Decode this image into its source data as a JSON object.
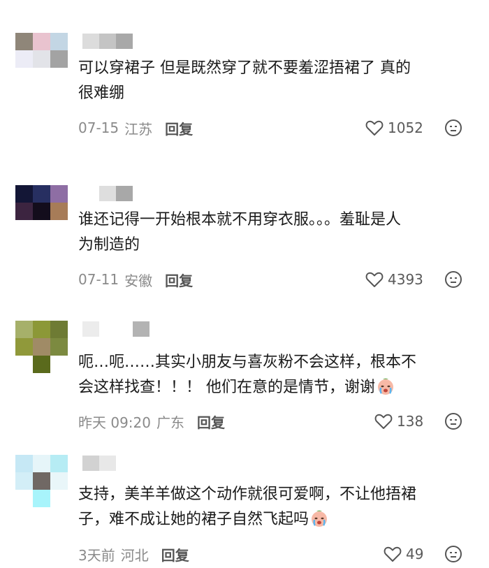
{
  "comments": [
    {
      "avatar_colors": [
        "#8f8679",
        "#e9c3cf",
        "#c3d6e4",
        "#ececf6",
        "#e2e3e8",
        "#a3a3a3",
        "#ffffff",
        "#ffffff",
        "#ffffff"
      ],
      "name_colors": [
        "#dcdcdc",
        "#c4c4c4",
        "#a8a8a8"
      ],
      "text": "可以穿裙子 但是既然穿了就不要羞涩捂裙了 真的\n很难绷",
      "date": "07-15",
      "location": "江苏",
      "reply_label": "回复",
      "likes": "1052"
    },
    {
      "avatar_colors": [
        "#131636",
        "#272f61",
        "#8e6ea4",
        "#3c2440",
        "#130d1c",
        "#a77c58",
        "#ffffff",
        "#ffffff",
        "#ffffff"
      ],
      "name_colors": [
        "#ffffff",
        "#dedede",
        "#a8a8a8"
      ],
      "text": "谁还记得一开始根本就不用穿衣服。。。羞耻是人\n为制造的",
      "date": "07-11",
      "location": "安徽",
      "reply_label": "回复",
      "likes": "4393"
    },
    {
      "avatar_colors": [
        "#a6b06a",
        "#8c9837",
        "#6e7b34",
        "#90993a",
        "#a08b66",
        "#7c8a40",
        "#ffffff",
        "#5a6a1c",
        "#ffffff"
      ],
      "name_colors": [
        "#ececec",
        "#ffffff",
        "#ffffff",
        "#b3b3b3"
      ],
      "text": "呃…呃……其实小朋友与喜灰粉不会这样，根本不\n会这样找查！！！ 他们在意的是情节，谢谢",
      "date": "昨天 09:20",
      "location": "广东",
      "reply_label": "回复",
      "likes": "138"
    },
    {
      "avatar_colors": [
        "#c6e8f5",
        "#e6f5f9",
        "#b6ecf4",
        "#d3eef7",
        "#706864",
        "#e9f6f9",
        "#ffffff",
        "#a8f4fb",
        "#ffffff"
      ],
      "name_colors": [
        "#d2d2d2",
        "#e8e8e8"
      ],
      "text": "支持，美羊羊做这个动作就很可爱啊，不让他捂裙\n子，难不成让她的裙子自然飞起吗",
      "date": "3天前",
      "location": "河北",
      "reply_label": "回复",
      "likes": "49"
    }
  ]
}
